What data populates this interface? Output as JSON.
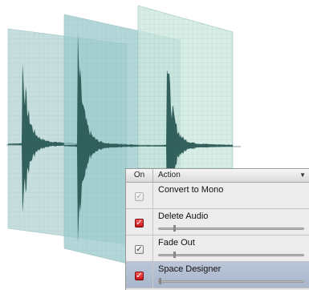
{
  "panel": {
    "header": {
      "on_label": "On",
      "action_label": "Action",
      "sort_icon": "triangle-down-icon"
    },
    "actions": [
      {
        "label": "Convert to Mono",
        "enabled": true,
        "checkbox_style": "disabled",
        "has_slider": false,
        "selected": false
      },
      {
        "label": "Delete Audio",
        "enabled": true,
        "checkbox_style": "red",
        "has_slider": true,
        "slider_value": 0.1,
        "selected": false
      },
      {
        "label": "Fade Out",
        "enabled": true,
        "checkbox_style": "normal",
        "has_slider": true,
        "slider_value": 0.1,
        "selected": false
      },
      {
        "label": "Space Designer",
        "enabled": true,
        "checkbox_style": "red",
        "has_slider": true,
        "slider_value": 0.0,
        "selected": true
      }
    ]
  },
  "colors": {
    "panel_back": "#b8d6d6",
    "panel_mid": "#9ecbcf",
    "panel_front": "#cde8df",
    "waveform": "#2a5a55",
    "selection": "#a9b6cb",
    "check_red": "#d42222"
  }
}
